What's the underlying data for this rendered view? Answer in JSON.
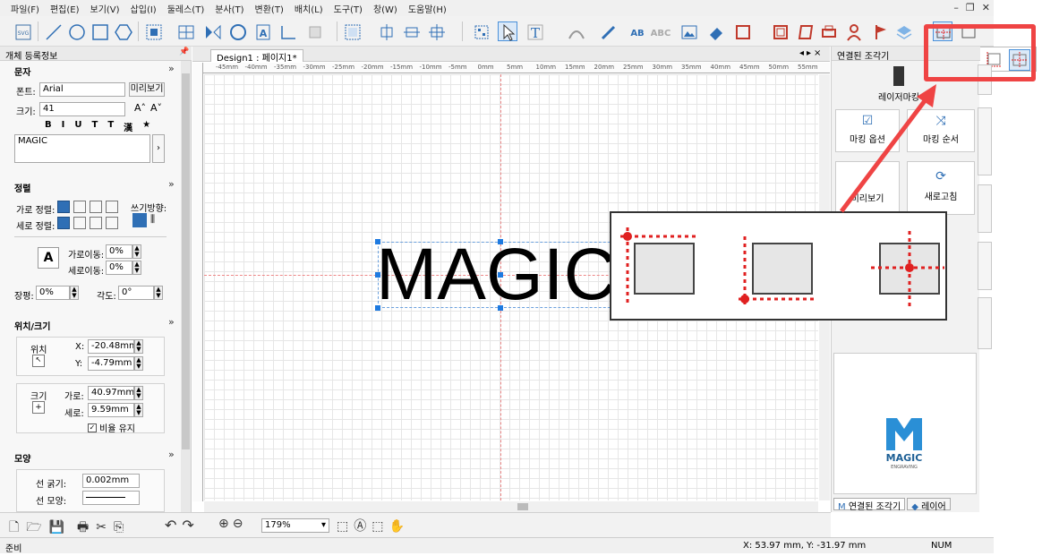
{
  "menu": [
    "파일(F)",
    "편집(E)",
    "보기(V)",
    "삽입(I)",
    "둘레스(T)",
    "분사(T)",
    "변환(T)",
    "배치(L)",
    "도구(T)",
    "창(W)",
    "도움말(H)"
  ],
  "window_controls": {
    "minimize": "–",
    "restore": "❐",
    "close": "✕"
  },
  "left_panel": {
    "title": "개체 등록정보",
    "text_section": {
      "heading": "문자",
      "font_label": "폰트:",
      "font_value": "Arial",
      "preview_button": "미리보기",
      "size_label": "크기:",
      "size_value": "41",
      "style_buttons": [
        "B",
        "I",
        "U",
        "T",
        "T",
        "漢",
        "★"
      ],
      "text_value": "MAGIC"
    },
    "align_section": {
      "heading": "정렬",
      "h_align_label": "가로 정렬:",
      "v_align_label": "세로 정렬:",
      "writing_dir_label": "쓰기방향:",
      "h_move_label": "가로이동:",
      "h_move_value": "0%",
      "v_move_label": "세로이동:",
      "v_move_value": "0%",
      "spacing_label": "장평:",
      "spacing_value": "0%",
      "angle_label": "각도:",
      "angle_value": "0°"
    },
    "position_section": {
      "heading": "위치/크기",
      "position_label": "위치",
      "x_label": "X:",
      "x_value": "-20.48mm",
      "y_label": "Y:",
      "y_value": "-4.79mm",
      "size_label": "크기",
      "width_label": "가로:",
      "width_value": "40.97mm",
      "height_label": "세로:",
      "height_value": "9.59mm",
      "keep_ratio": "비율 유지"
    },
    "shape_section": {
      "heading": "모양",
      "line_width_label": "선 굵기:",
      "line_width_value": "0.002mm",
      "line_shape_label": "선 모양:"
    }
  },
  "document": {
    "tab": "Design1 : 페이지1*",
    "canvas_text": "MAGIC",
    "ruler_labels": [
      "-45mm",
      "-40mm",
      "-35mm",
      "-30mm",
      "-25mm",
      "-20mm",
      "-15mm",
      "-10mm",
      "-5mm",
      "0mm",
      "5mm",
      "10mm",
      "15mm",
      "20mm",
      "25mm",
      "30mm",
      "35mm",
      "40mm",
      "45mm",
      "50mm",
      "55mm"
    ]
  },
  "right_panel": {
    "title": "연결된 조각기",
    "laser_button": "레이저마킹",
    "marking_options": "마킹 옵션",
    "marking_order": "마킹 순서",
    "preview": "미리보기",
    "refresh": "새로고침",
    "logo_text": "MAGIC",
    "logo_sub": "ENGRAVING",
    "bottom_tabs": [
      "연결된 조각기",
      "레이어"
    ]
  },
  "bottom_toolbar": {
    "zoom_value": "179%"
  },
  "status": {
    "left": "준비",
    "coords": "X: 53.97 mm, Y: -31.97 mm",
    "num": "NUM"
  },
  "colors": {
    "accent": "#1e7ae0",
    "highlight": "#ef4444",
    "guide": "#e02020"
  }
}
